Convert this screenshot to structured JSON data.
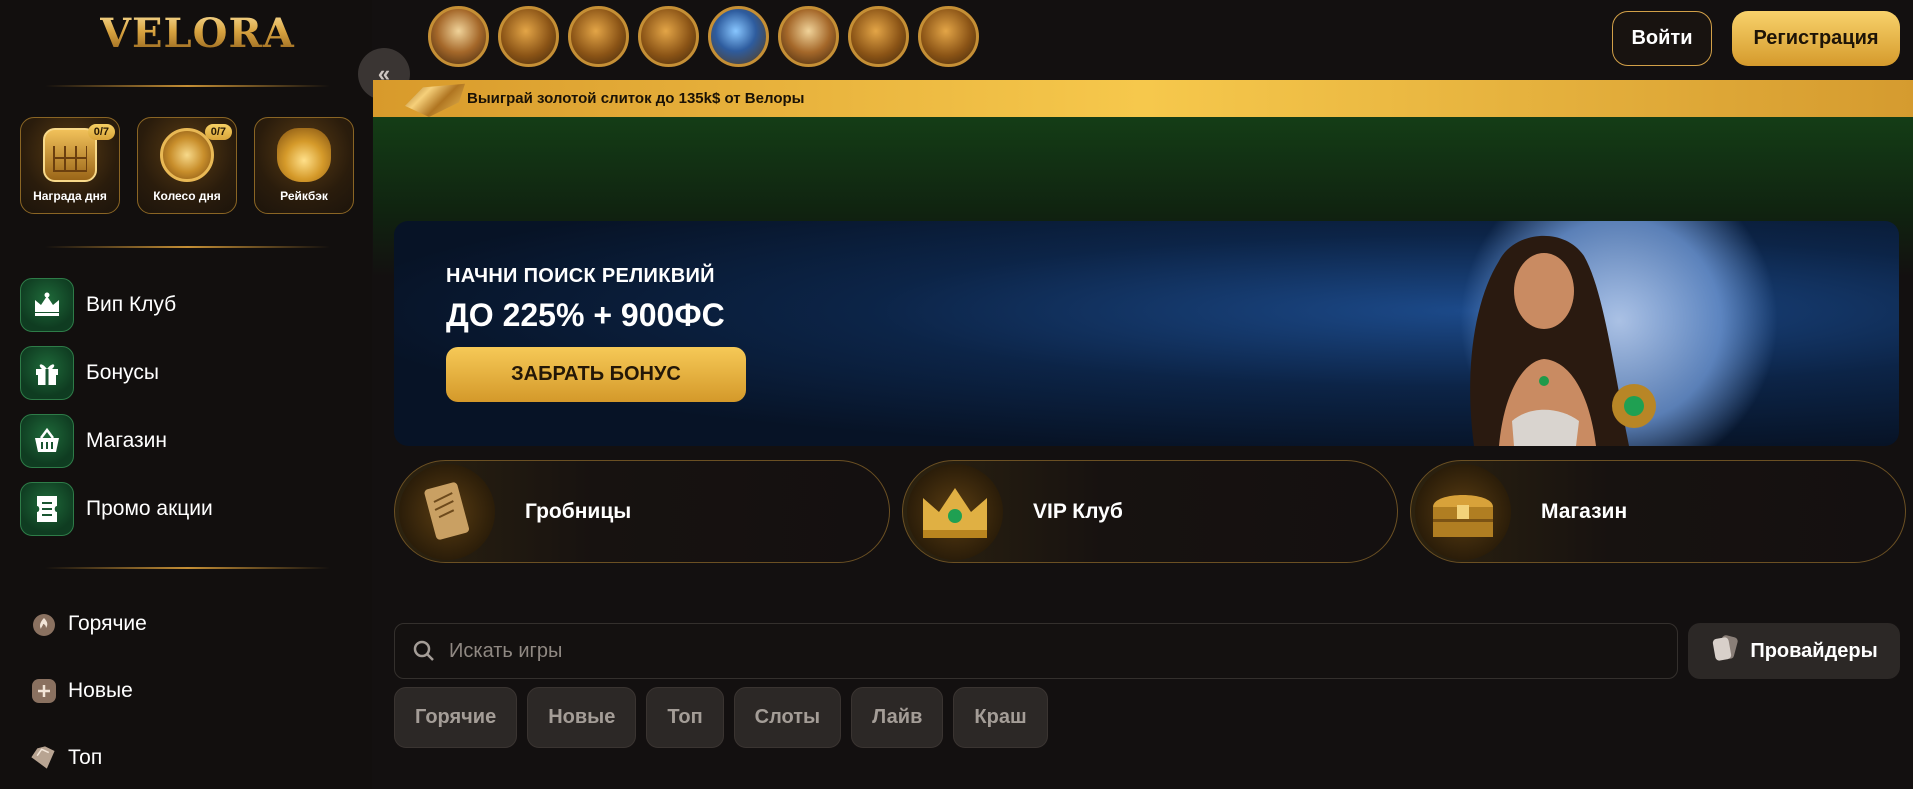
{
  "brand": {
    "logo_text": "VELORA",
    "accent": "#f1c04f",
    "dark_bg": "#131010"
  },
  "daily": [
    {
      "label": "Награда дня",
      "badge": "0/7",
      "icon": "calendar-icon"
    },
    {
      "label": "Колесо дня",
      "badge": "0/7",
      "icon": "wheel-icon"
    },
    {
      "label": "Рейкбэк",
      "badge": "",
      "icon": "money-bag-icon"
    }
  ],
  "menu_primary": [
    {
      "label": "Вип Клуб",
      "icon": "crown-icon"
    },
    {
      "label": "Бонусы",
      "icon": "gift-icon"
    },
    {
      "label": "Магазин",
      "icon": "basket-icon"
    },
    {
      "label": "Промо акции",
      "icon": "ticket-icon"
    }
  ],
  "menu_secondary": [
    {
      "label": "Горячие",
      "icon": "fire-icon"
    },
    {
      "label": "Новые",
      "icon": "plus-icon"
    },
    {
      "label": "Топ",
      "icon": "diamond-icon"
    }
  ],
  "header": {
    "login": "Войти",
    "register": "Регистрация",
    "collapse": "«"
  },
  "promo_strip": {
    "text": "Выиграй золотой слиток до 135k$ от Велоры"
  },
  "hero": {
    "subtitle": "НАЧНИ ПОИСК РЕЛИКВИЙ",
    "title": "ДО 225% + 900ФС",
    "cta": "ЗАБРАТЬ БОНУС"
  },
  "categories": [
    {
      "label": "Гробницы",
      "icon": "scroll-icon"
    },
    {
      "label": "VIP Клуб",
      "icon": "crown-icon"
    },
    {
      "label": "Магазин",
      "icon": "chest-icon"
    }
  ],
  "search": {
    "placeholder": "Искать игры"
  },
  "providers": {
    "label": "Провайдеры"
  },
  "tabs": [
    "Горячие",
    "Новые",
    "Топ",
    "Слоты",
    "Лайв",
    "Краш"
  ]
}
